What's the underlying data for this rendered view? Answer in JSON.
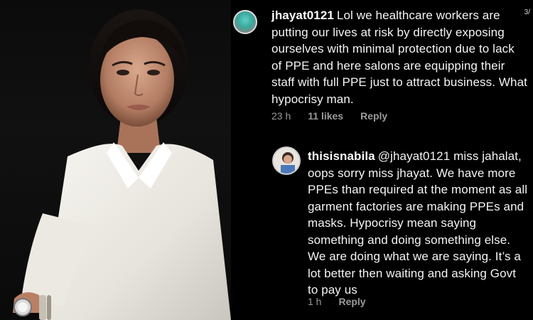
{
  "comments": [
    {
      "username": "jhayat0121",
      "text": "Lol we healthcare workers are putting our lives at risk by directly exposing ourselves with minimal protection due to lack of PPE and here salons are equipping their staff with full PPE just to attract business. What hypocrisy man.",
      "time": "23 h",
      "likes": "11 likes",
      "reply": "Reply",
      "side_number": "3/"
    },
    {
      "username": "thisisnabila",
      "text": "@jhayat0121 miss jahalat, oops sorry miss jhayat. We have more PPEs than required at the moment as all garment factories are making PPEs and masks. Hypocrisy mean saying something and doing something else. We are doing what we are saying. It’s a lot better then waiting and asking Govt to pay us",
      "time": "1 h",
      "reply": "Reply"
    }
  ],
  "colors": {
    "background": "#000000",
    "text": "#f4f4f4",
    "meta": "#9a9a9a"
  }
}
